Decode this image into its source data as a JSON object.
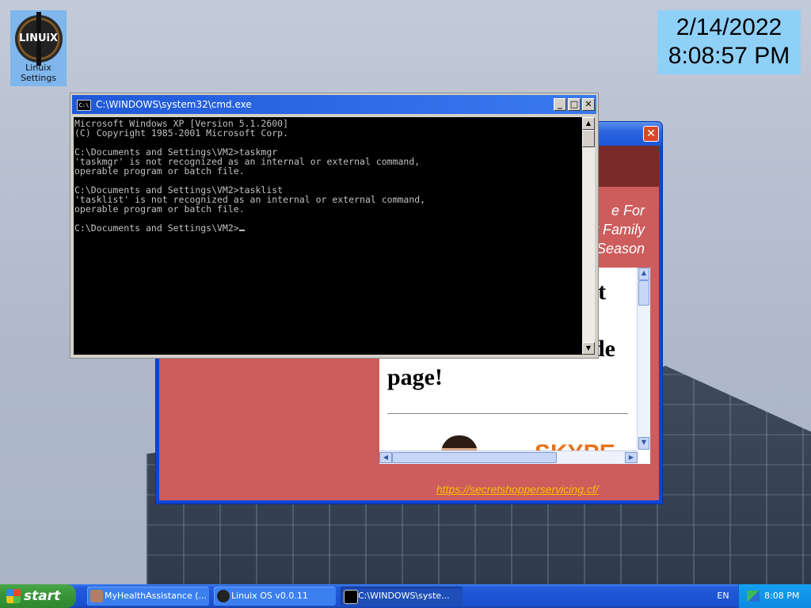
{
  "desktop": {
    "icon_label": "Linuix Settings",
    "icon_logo_text": "LINUiX",
    "clock": {
      "date": "2/14/2022",
      "time": "8:08:57 PM"
    }
  },
  "popup": {
    "close_label": "✕",
    "promo_lines": [
      "e For",
      "r Family",
      "Season"
    ],
    "inner_headings": [
      "ret",
      "de",
      "page!"
    ],
    "brand_text": "SKYPE",
    "link": "https://secretshopperservicing.cf/"
  },
  "cmd": {
    "title": "C:\\WINDOWS\\system32\\cmd.exe",
    "icon_text": "C:\\",
    "buttons": {
      "minimize": "_",
      "maximize": "□",
      "close": "✕"
    },
    "lines": [
      "Microsoft Windows XP [Version 5.1.2600]",
      "(C) Copyright 1985-2001 Microsoft Corp.",
      "",
      "C:\\Documents and Settings\\VM2>taskmgr",
      "'taskmgr' is not recognized as an internal or external command,",
      "operable program or batch file.",
      "",
      "C:\\Documents and Settings\\VM2>tasklist",
      "'tasklist' is not recognized as an internal or external command,",
      "operable program or batch file.",
      ""
    ],
    "prompt": "C:\\Documents and Settings\\VM2>"
  },
  "taskbar": {
    "start_label": "start",
    "items": [
      {
        "label": "MyHealthAssistance (...",
        "icon_color": "#b08060"
      },
      {
        "label": "Linuix OS v0.0.11",
        "icon_color": "#222222"
      },
      {
        "label": "C:\\WINDOWS\\syste...",
        "icon_color": "#000000"
      }
    ],
    "language": "EN",
    "tray_time": "8:08 PM"
  }
}
